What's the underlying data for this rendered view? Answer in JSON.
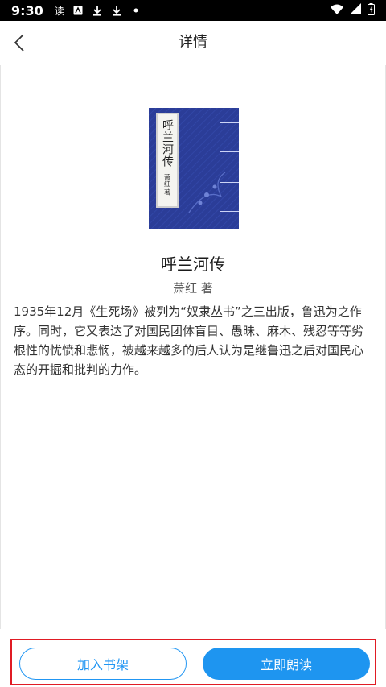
{
  "status_bar": {
    "time": "9:30",
    "notif_text": "读"
  },
  "nav": {
    "title": "详情"
  },
  "book": {
    "cover_title": "呼兰河传",
    "cover_author": "萧红 著",
    "title": "呼兰河传",
    "author": "萧红 著",
    "description": "1935年12月《生死场》被列为“奴隶丛书”之三出版，鲁迅为之作序。同时，它又表达了对国民团体盲目、愚昧、麻木、残忍等等劣根性的忧愤和悲悯，被越来越多的后人认为是继鲁迅之后对国民心态的开掘和批判的力作。"
  },
  "actions": {
    "add_shelf": "加入书架",
    "read_now": "立即朗读"
  },
  "colors": {
    "accent": "#1e95f0",
    "highlight_border": "#e01b24",
    "cover_blue": "#2c3f9c"
  },
  "icons": {
    "back": "chevron-left-icon",
    "download": "download-icon",
    "wifi": "wifi-icon",
    "signal": "signal-icon",
    "battery": "battery-icon"
  }
}
